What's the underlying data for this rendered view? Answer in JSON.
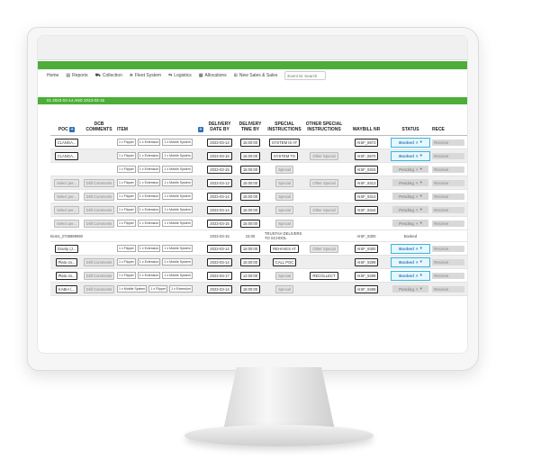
{
  "nav": {
    "items": [
      "Home",
      "Reports",
      "Collection",
      "Fleet System",
      "Logistics",
      "Allocations",
      "New Sales & Sales"
    ],
    "search_placeholder": "Event Nr Search"
  },
  "date_range": "01 2023-03-14 AND 2023-03-15",
  "headers": {
    "poc": "POC",
    "dcb_comments": "DCB COMMENTS",
    "item": "ITEM",
    "delivery_date": "DELIVERY DATE BY",
    "delivery_time": "DELIVERY TIME BY",
    "special_instructions": "SPECIAL INSTRUCTIONS",
    "other_special": "OTHER SPECIAL INSTRUCTIONS",
    "waybill": "WAYBILL NR",
    "status": "STATUS",
    "receive": "RECE"
  },
  "rows": [
    {
      "poc": "CLANGA...",
      "comment": "",
      "tags": [
        "1 x Flipper",
        "1 x Extension",
        "1 x Mobile System"
      ],
      "date": "2023-03-14",
      "time": "15:00:00",
      "special": "SYSTEM IS AT",
      "other": "",
      "waybill": "AISF_8673",
      "status": "Booked",
      "rec": "Receive"
    },
    {
      "poc": "CLANGA...",
      "comment": "",
      "tags": [
        "1 x Flipper",
        "1 x Extension",
        "1 x Mobile System"
      ],
      "date": "2023-03-15",
      "time": "15:00:00",
      "special": "SYSTEM TO",
      "other": "Other Special",
      "waybill": "AISF_8670",
      "status": "Booked",
      "rec": "Receive"
    },
    {
      "poc": "",
      "comment": "",
      "tags": [
        "1 x Flipper",
        "1 x Extension",
        "1 x Mobile System"
      ],
      "date": "2023-03-15",
      "time": "15:00:00",
      "special": "Special",
      "other": "",
      "waybill": "AISF_9315",
      "status": "Pending",
      "rec": "Receive"
    },
    {
      "poc": "Select per...",
      "comment": "Drill Comments",
      "tags": [
        "1 x Flipper",
        "1 x Extension",
        "1 x Mobile System"
      ],
      "date": "2023-03-13",
      "time": "15:00:00",
      "special": "Special",
      "other": "Other Special",
      "waybill": "AISF_9313",
      "status": "Pending",
      "rec": "Receive"
    },
    {
      "poc": "Select per...",
      "comment": "Drill Comments",
      "tags": [
        "1 x Flipper",
        "1 x Extension",
        "1 x Mobile System"
      ],
      "date": "2023-03-14",
      "time": "15:00:00",
      "special": "Special",
      "other": "",
      "waybill": "AISF_9314",
      "status": "Pending",
      "rec": "Receive"
    },
    {
      "poc": "Select per...",
      "comment": "Drill Comments",
      "tags": [
        "1 x Flipper",
        "1 x Extension",
        "1 x Mobile System"
      ],
      "date": "2023-03-14",
      "time": "15:00:00",
      "special": "Special",
      "other": "Other Special",
      "waybill": "AISF_9344",
      "status": "Pending",
      "rec": "Receive"
    },
    {
      "poc": "Select per...",
      "comment": "Drill Comments",
      "tags": [
        "1 x Flipper",
        "1 x Extension",
        "1 x Mobile System"
      ],
      "date": "2023-03-15",
      "time": "15:00:00",
      "special": "Special",
      "other": "",
      "waybill": "",
      "status": "Pending",
      "rec": "Receive"
    }
  ],
  "subheader": {
    "label": "Items_2738899090",
    "date": "2023-03-15",
    "time": "15:00",
    "special": "TRUSTAH DELIVERS TO SCHOOL",
    "waybill": "AISF_9300",
    "status": "Booked"
  },
  "rows2": [
    {
      "poc": "Granty (J...",
      "comment": "",
      "tags": [
        "1 x Flipper",
        "1 x Extension",
        "1 x Mobile System"
      ],
      "date": "2023-03-14",
      "time": "15:00:00",
      "special": "REHAVES AT",
      "other": "Other Special",
      "waybill": "AISF_9300",
      "status": "Booked",
      "rec": "Receive"
    },
    {
      "poc": "Plato-Jo...",
      "comment": "Drill Comments",
      "tags": [
        "1 x Flipper",
        "1 x Extension",
        "1 x Mobile System"
      ],
      "date": "2023-03-14",
      "time": "15:00:00",
      "special": "CALL POC",
      "other": "",
      "waybill": "AISF_9299",
      "status": "Booked",
      "rec": "Receive"
    },
    {
      "poc": "Plato-Jo...",
      "comment": "Drill Comments",
      "tags": [
        "1 x Flipper",
        "1 x Extension",
        "1 x Mobile System"
      ],
      "date": "2023-03-17",
      "time": "12:00:00",
      "special": "Special",
      "other": "RECOLLECT",
      "waybill": "AISF_9299",
      "status": "Booked",
      "rec": "Receive"
    },
    {
      "poc": "KABIA (...",
      "comment": "Drill Comments",
      "tags": [
        "1 x Mobile System",
        "1 x Flipper",
        "1 x Extension"
      ],
      "date": "2023-03-14",
      "time": "18:00:00",
      "special": "Special",
      "other": "",
      "waybill": "AISF_9298",
      "status": "Pending",
      "rec": "Receive"
    }
  ],
  "colors": {
    "green": "#4cae38",
    "status_border": "#35b5e0",
    "status_text": "#3a7bbf",
    "plus": "#2f6fb5"
  }
}
